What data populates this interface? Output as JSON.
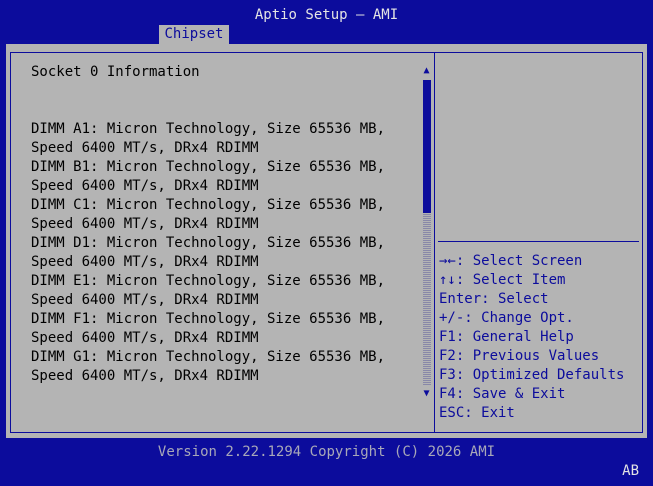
{
  "header": {
    "title": "Aptio Setup – AMI",
    "active_tab": "Chipset"
  },
  "main": {
    "section_title": "Socket 0 Information",
    "dimms": [
      {
        "line1": "DIMM A1: Micron Technology, Size 65536 MB,",
        "line2": "Speed 6400 MT/s, DRx4 RDIMM"
      },
      {
        "line1": "DIMM B1: Micron Technology, Size 65536 MB,",
        "line2": "Speed 6400 MT/s, DRx4 RDIMM"
      },
      {
        "line1": "DIMM C1: Micron Technology, Size 65536 MB,",
        "line2": "Speed 6400 MT/s, DRx4 RDIMM"
      },
      {
        "line1": "DIMM D1: Micron Technology, Size 65536 MB,",
        "line2": "Speed 6400 MT/s, DRx4 RDIMM"
      },
      {
        "line1": "DIMM E1: Micron Technology, Size 65536 MB,",
        "line2": "Speed 6400 MT/s, DRx4 RDIMM"
      },
      {
        "line1": "DIMM F1: Micron Technology, Size 65536 MB,",
        "line2": "Speed 6400 MT/s, DRx4 RDIMM"
      },
      {
        "line1": "DIMM G1: Micron Technology, Size 65536 MB,",
        "line2": "Speed 6400 MT/s, DRx4 RDIMM"
      }
    ]
  },
  "scrollbar": {
    "up_arrow": "▲",
    "down_arrow": "▼"
  },
  "help": {
    "items": [
      "→←: Select Screen",
      "↑↓: Select Item",
      "Enter: Select",
      "+/-: Change Opt.",
      "F1: General Help",
      "F2: Previous Values",
      "F3: Optimized Defaults",
      "F4: Save & Exit",
      "ESC: Exit"
    ]
  },
  "footer": {
    "version": "Version 2.22.1294 Copyright (C) 2026 AMI",
    "corner_label": "AB"
  },
  "colors": {
    "background_blue": "#0c0c9c",
    "panel_gray": "#b4b4b4",
    "help_text": "#0c0c9c"
  }
}
